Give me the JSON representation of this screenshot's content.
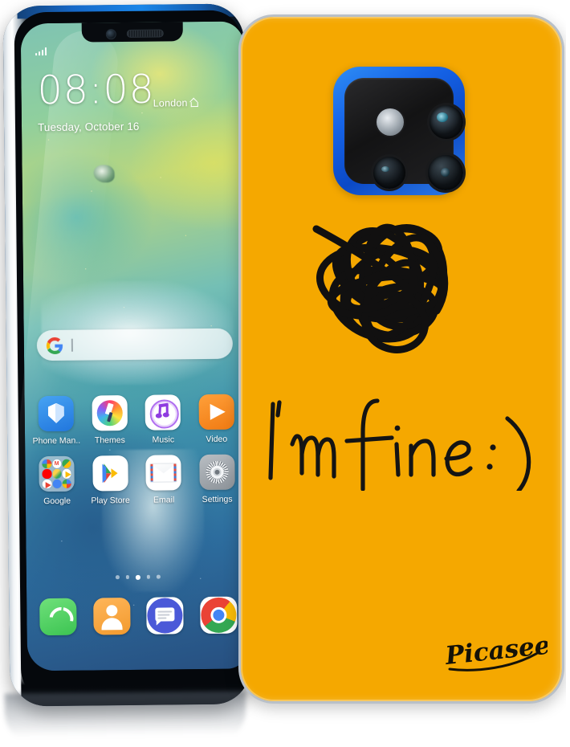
{
  "product": {
    "brand": "Picasee",
    "case_color_hex": "#F5A800",
    "case_design_text": "I'm fine :)",
    "case_design_motif": "scribble-doodle"
  },
  "phone": {
    "device_color_hex": "#1A86E8",
    "screen": {
      "status": {
        "signal_icon": "signal-bars-icon"
      },
      "lockscreen": {
        "time": "08:08",
        "city": "London",
        "city_icon": "home-icon",
        "date": "Tuesday, October 16"
      },
      "search": {
        "icon": "google-g-icon",
        "placeholder": ""
      },
      "apps": [
        [
          {
            "label": "Phone Man..",
            "icon": "shield-icon"
          },
          {
            "label": "Themes",
            "icon": "paintbrush-icon"
          },
          {
            "label": "Music",
            "icon": "music-note-icon"
          },
          {
            "label": "Video",
            "icon": "play-triangle-icon"
          }
        ],
        [
          {
            "label": "Google",
            "icon": "google-folder-icon"
          },
          {
            "label": "Play Store",
            "icon": "play-store-icon"
          },
          {
            "label": "Email",
            "icon": "envelope-icon"
          },
          {
            "label": "Settings",
            "icon": "gear-icon"
          }
        ]
      ],
      "page_dots": {
        "count": 5,
        "active_index": 2
      },
      "dock": [
        {
          "label": "Phone",
          "icon": "phone-handset-icon"
        },
        {
          "label": "Contacts",
          "icon": "person-icon"
        },
        {
          "label": "Messages",
          "icon": "chat-bubble-icon"
        },
        {
          "label": "Chrome",
          "icon": "chrome-icon"
        }
      ]
    }
  }
}
